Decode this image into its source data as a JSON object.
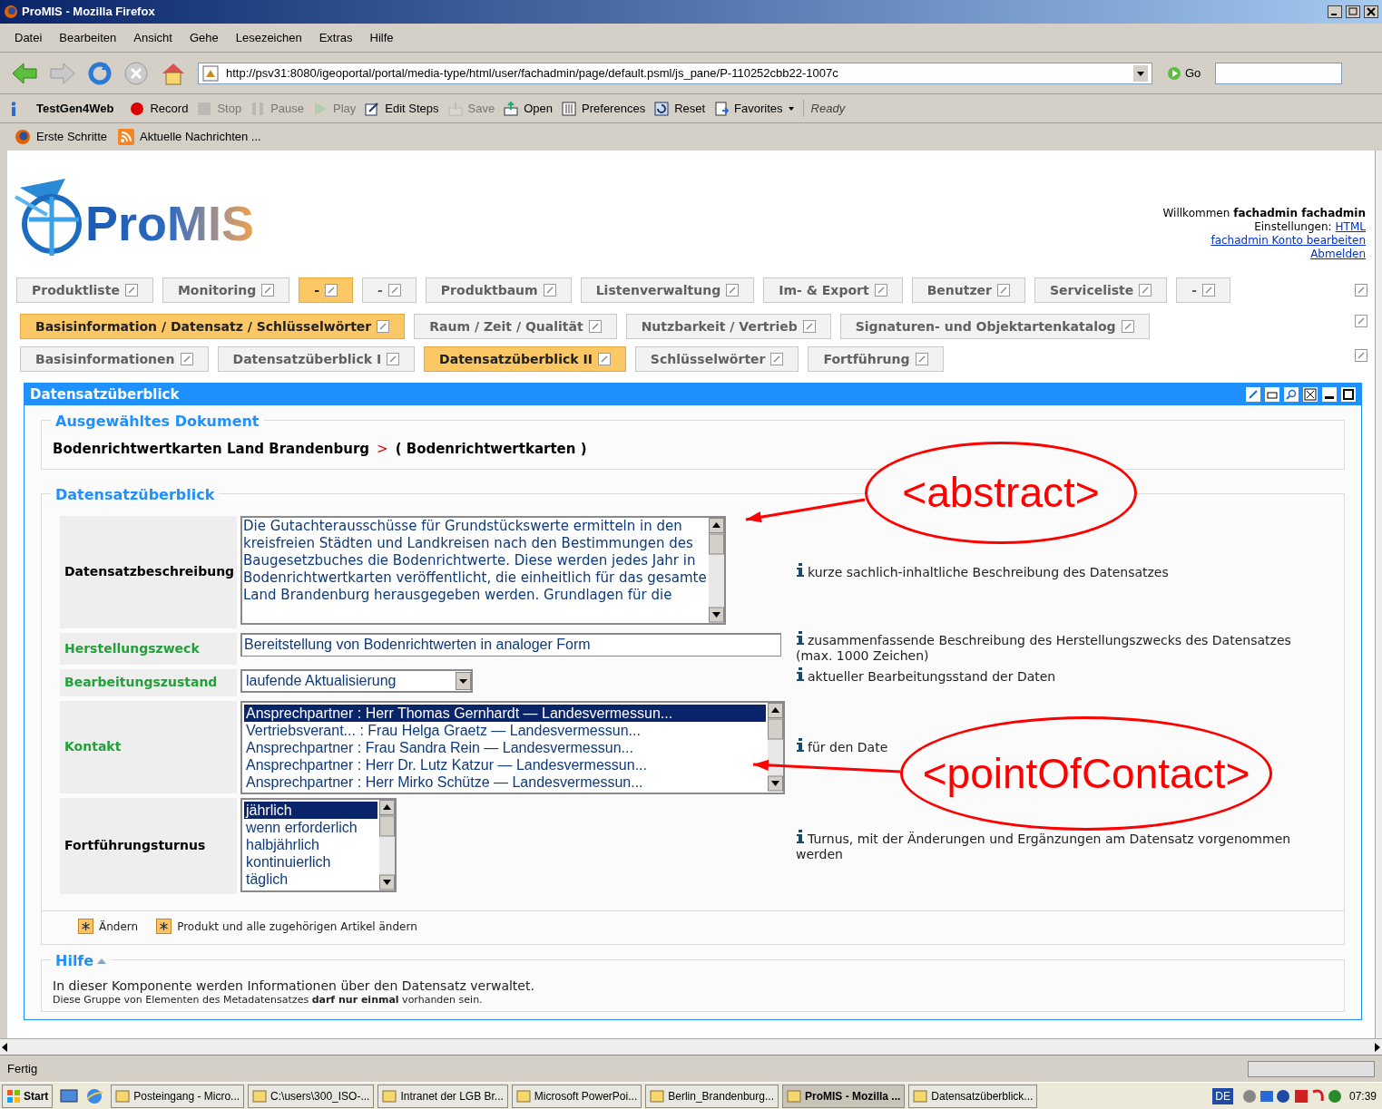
{
  "window": {
    "title": "ProMIS - Mozilla Firefox"
  },
  "menu": [
    "Datei",
    "Bearbeiten",
    "Ansicht",
    "Gehe",
    "Lesezeichen",
    "Extras",
    "Hilfe"
  ],
  "address_bar": {
    "url": "http://psv31:8080/igeoportal/portal/media-type/html/user/fachadmin/page/default.psml/js_pane/P-110252cbb22-1007c"
  },
  "go_button": "Go",
  "testgen_title": "TestGen4Web",
  "testgen_status": "Ready",
  "testgen_toolbar": [
    {
      "kind": "record",
      "label": "Record",
      "disabled": false
    },
    {
      "kind": "stop",
      "label": "Stop",
      "disabled": true
    },
    {
      "kind": "pause",
      "label": "Pause",
      "disabled": true
    },
    {
      "kind": "play",
      "label": "Play",
      "disabled": true
    },
    {
      "kind": "edit",
      "label": "Edit Steps",
      "disabled": false
    },
    {
      "kind": "save",
      "label": "Save",
      "disabled": true
    },
    {
      "kind": "open",
      "label": "Open",
      "disabled": false
    },
    {
      "kind": "prefs",
      "label": "Preferences",
      "disabled": false
    },
    {
      "kind": "reset",
      "label": "Reset",
      "disabled": false
    },
    {
      "kind": "favorites",
      "label": "Favorites",
      "disabled": false
    }
  ],
  "bookmarks": [
    {
      "kind": "firefox",
      "label": "Erste Schritte"
    },
    {
      "kind": "feed",
      "label": "Aktuelle Nachrichten ..."
    }
  ],
  "logo": {
    "text": "ProMIS"
  },
  "user_panel": {
    "welcome": "Willkommen",
    "user": "fachadmin fachadmin",
    "settings_label": "Einstellungen:",
    "settings_link": "HTML",
    "account_link": "fachadmin Konto bearbeiten",
    "logout_link": "Abmelden"
  },
  "tabs_level1": [
    {
      "label": "Produktliste",
      "selected": false
    },
    {
      "label": "Monitoring",
      "selected": false
    },
    {
      "label": "-",
      "selected": true
    },
    {
      "label": "-",
      "selected": false
    },
    {
      "label": "Produktbaum",
      "selected": false
    },
    {
      "label": "Listenverwaltung",
      "selected": false
    },
    {
      "label": "Im- & Export",
      "selected": false
    },
    {
      "label": "Benutzer",
      "selected": false
    },
    {
      "label": "Serviceliste",
      "selected": false
    },
    {
      "label": "-",
      "selected": false
    }
  ],
  "tabs_level2": [
    {
      "label": "Basisinformation / Datensatz / Schlüsselwörter",
      "selected": true
    },
    {
      "label": "Raum / Zeit / Qualität",
      "selected": false
    },
    {
      "label": "Nutzbarkeit / Vertrieb",
      "selected": false
    },
    {
      "label": "Signaturen- und Objektartenkatalog",
      "selected": false
    }
  ],
  "tabs_level3": [
    {
      "label": "Basisinformationen",
      "selected": false
    },
    {
      "label": "Datensatzüberblick I",
      "selected": false
    },
    {
      "label": "Datensatzüberblick II",
      "selected": true
    },
    {
      "label": "Schlüsselwörter",
      "selected": false
    },
    {
      "label": "Fortführung",
      "selected": false
    }
  ],
  "portlet": {
    "title": "Datensatzüberblick"
  },
  "selected_document": {
    "legend": "Ausgewähltes Dokument",
    "title": "Bodenrichtwertkarten Land Brandenburg",
    "separator": ">",
    "subtitle": "( Bodenrichtwertkarten )"
  },
  "overview": {
    "legend": "Datensatzüberblick",
    "fields": [
      {
        "kind": "textarea",
        "label": "Datensatzbeschreibung",
        "mandatory": true,
        "value": "Die Gutachterausschüsse für Grundstückswerte ermitteln in den kreisfreien Städten und Landkreisen nach den Bestimmungen des Baugesetzbuches die Bodenrichtwerte. Diese werden jedes Jahr in Bodenrichtwertkarten veröffentlicht, die einheitlich für das gesamte Land Brandenburg herausgegeben werden. Grundlagen für die",
        "hint": "kurze sachlich-inhaltliche Beschreibung des Datensatzes"
      },
      {
        "kind": "input",
        "label": "Herstellungszweck",
        "mandatory": false,
        "value": "Bereitstellung von Bodenrichtwerten in analoger Form",
        "hint": "zusammenfassende Beschreibung des Herstellungszwecks des Datensatzes (max. 1000 Zeichen)"
      },
      {
        "kind": "select",
        "label": "Bearbeitungszustand",
        "mandatory": false,
        "value": "laufende Aktualisierung",
        "hint": "aktueller Bearbeitungsstand der Daten"
      },
      {
        "kind": "listbox",
        "label": "Kontakt",
        "mandatory": false,
        "options": [
          {
            "label": "Ansprechpartner : Herr Thomas Gernhardt — Landesvermessun...",
            "selected": true
          },
          {
            "label": "Vertriebsverant... : Frau Helga Graetz — Landesvermessun...",
            "selected": false
          },
          {
            "label": "Ansprechpartner : Frau Sandra Rein — Landesvermessun...",
            "selected": false
          },
          {
            "label": "Ansprechpartner : Herr Dr. Lutz Katzur — Landesvermessun...",
            "selected": false
          },
          {
            "label": "Ansprechpartner : Herr Mirko Schütze — Landesvermessun...",
            "selected": false
          }
        ],
        "hint": "für den Date"
      },
      {
        "kind": "listbox_small",
        "label": "Fortführungsturnus",
        "mandatory": true,
        "options": [
          {
            "label": "jährlich",
            "selected": true
          },
          {
            "label": "wenn erforderlich",
            "selected": false
          },
          {
            "label": "halbjährlich",
            "selected": false
          },
          {
            "label": "kontinuierlich",
            "selected": false
          },
          {
            "label": "täglich",
            "selected": false
          }
        ],
        "hint": "Turnus, mit der Änderungen und Ergänzungen am Datensatz vorgenommen werden"
      }
    ],
    "actions": [
      "Ändern",
      "Produkt und alle zugehörigen Artikel ändern"
    ]
  },
  "help": {
    "legend": "Hilfe",
    "text": "In dieser Komponente werden Informationen über den Datensatz verwaltet.",
    "note": "Diese Gruppe von Elementen des Metadatensatzes **darf nur einmal** vorhanden sein."
  },
  "annotations": [
    {
      "text": "<abstract>"
    },
    {
      "text": "<pointOfContact>"
    }
  ],
  "status_bar": {
    "text": "Fertig"
  },
  "taskbar": {
    "start": "Start",
    "items": [
      {
        "label": "Posteingang - Micro...",
        "selected": false
      },
      {
        "label": "C:\\users\\300_ISO-...",
        "selected": false
      },
      {
        "label": "Intranet der LGB Br...",
        "selected": false
      },
      {
        "label": "Microsoft PowerPoi...",
        "selected": false
      },
      {
        "label": "Berlin_Brandenburg...",
        "selected": false
      },
      {
        "label": "ProMIS - Mozilla ...",
        "selected": true
      },
      {
        "label": "Datensatzüberblick...",
        "selected": false
      }
    ],
    "language": "DE",
    "clock": "07:39"
  }
}
